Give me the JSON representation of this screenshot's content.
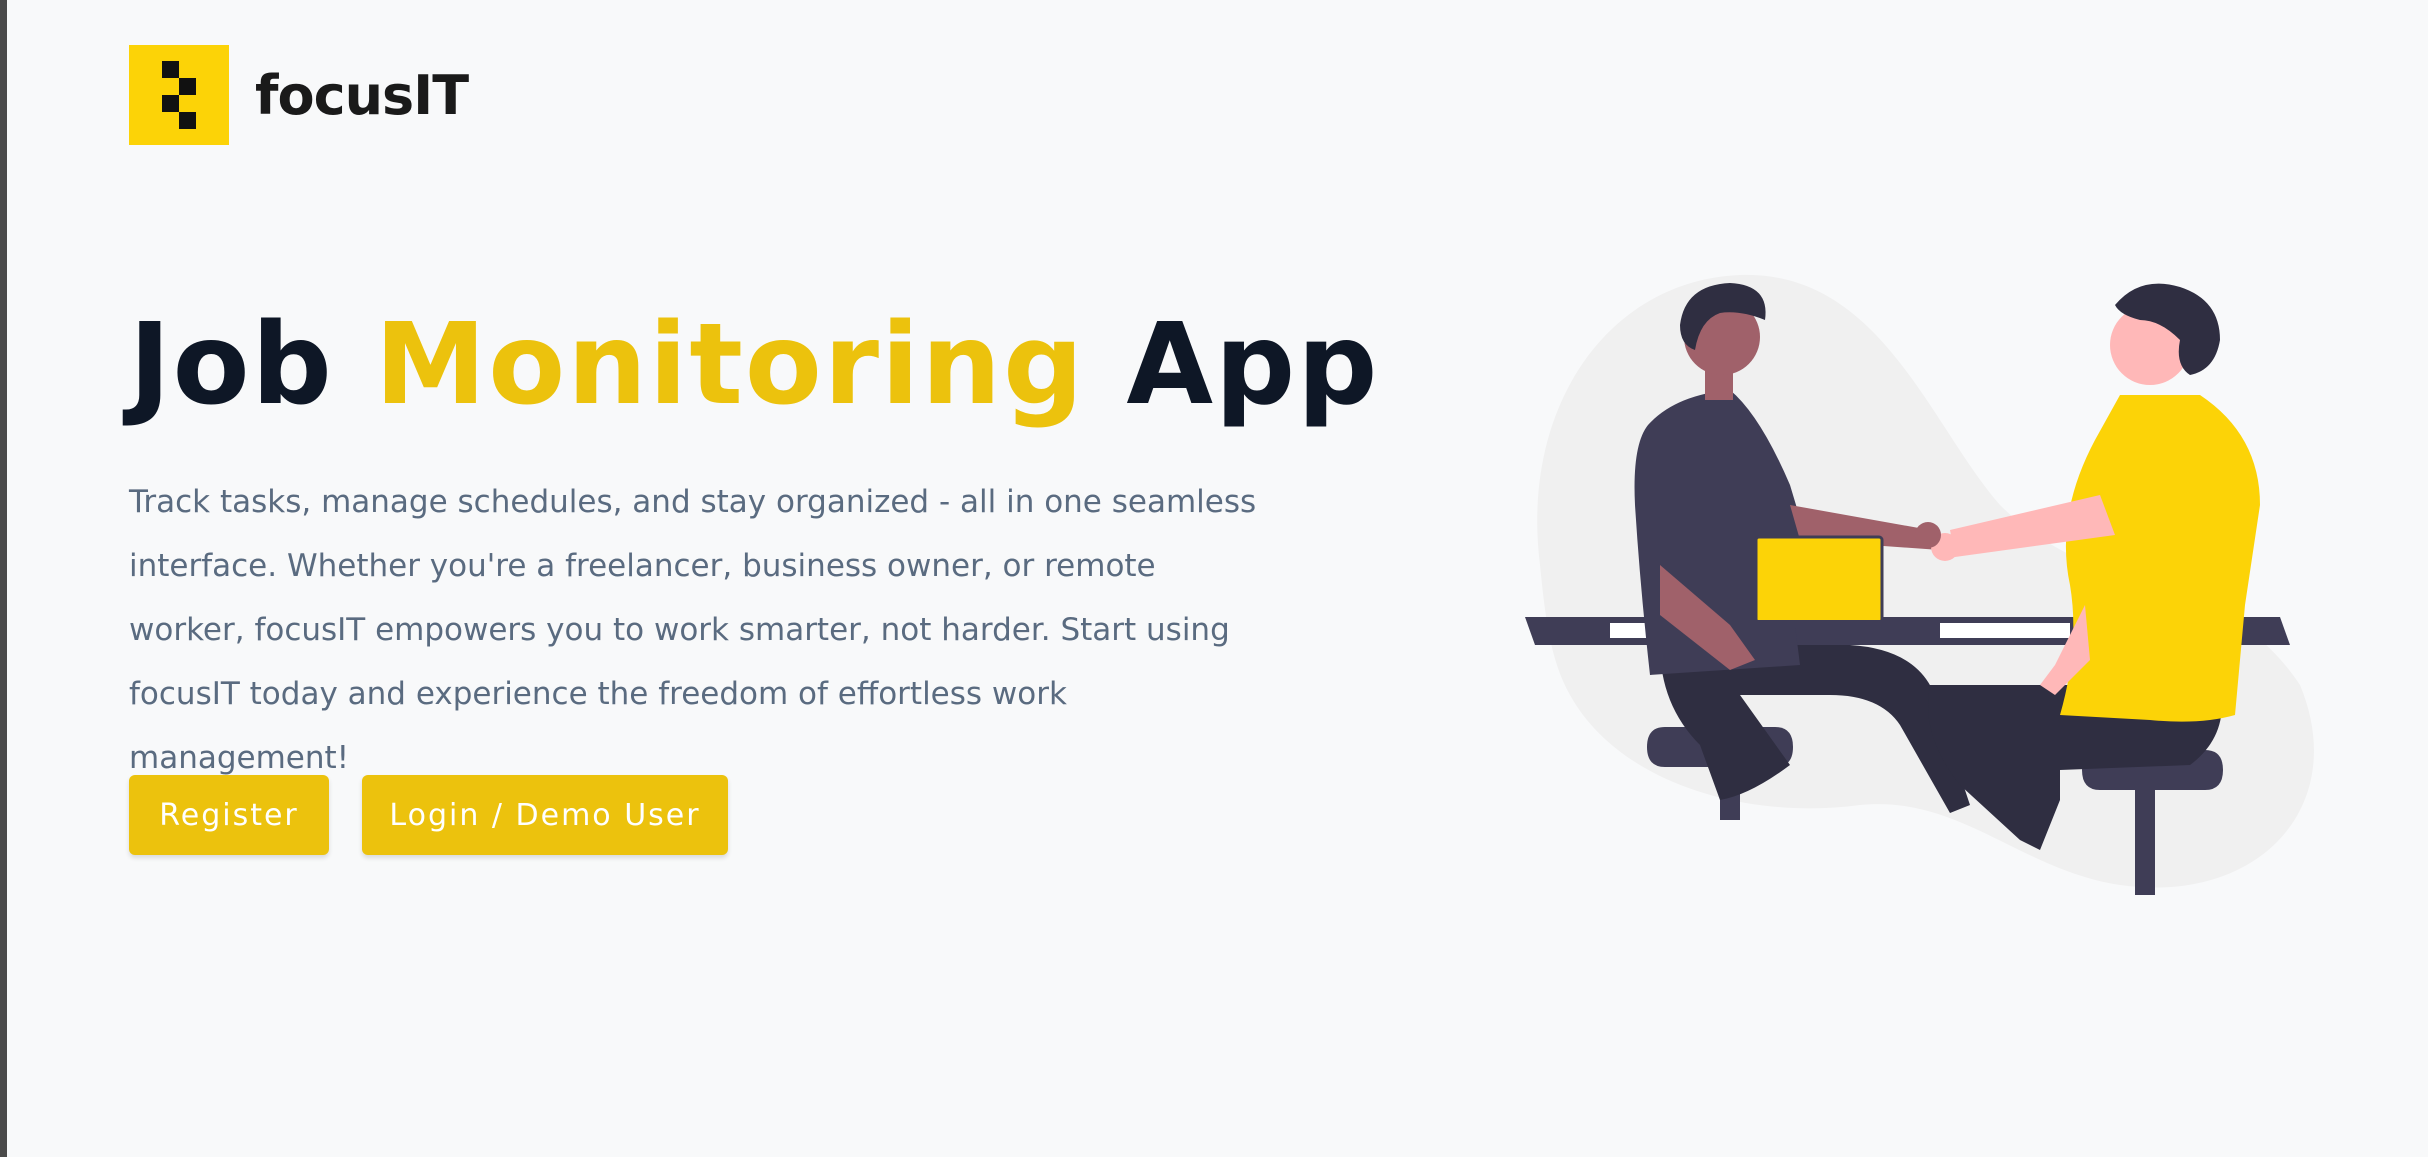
{
  "brand": {
    "name": "focusIT",
    "logo_color": "#fcd307"
  },
  "hero": {
    "title_part1": "Job",
    "title_accent": "Monitoring",
    "title_part2": "App",
    "description": "Track tasks, manage schedules, and stay organized - all in one seamless interface. Whether you're a freelancer, business owner, or remote worker, focusIT empowers you to work smarter, not harder. Start using focusIT today and experience the freedom of effortless work management!"
  },
  "buttons": {
    "register": "Register",
    "login": "Login / Demo User"
  },
  "illustration": {
    "icon": "handshake-illustration"
  },
  "colors": {
    "accent": "#ecc20d",
    "title": "#0e1726",
    "text": "#5a6b80",
    "background": "#f8f9fa"
  }
}
